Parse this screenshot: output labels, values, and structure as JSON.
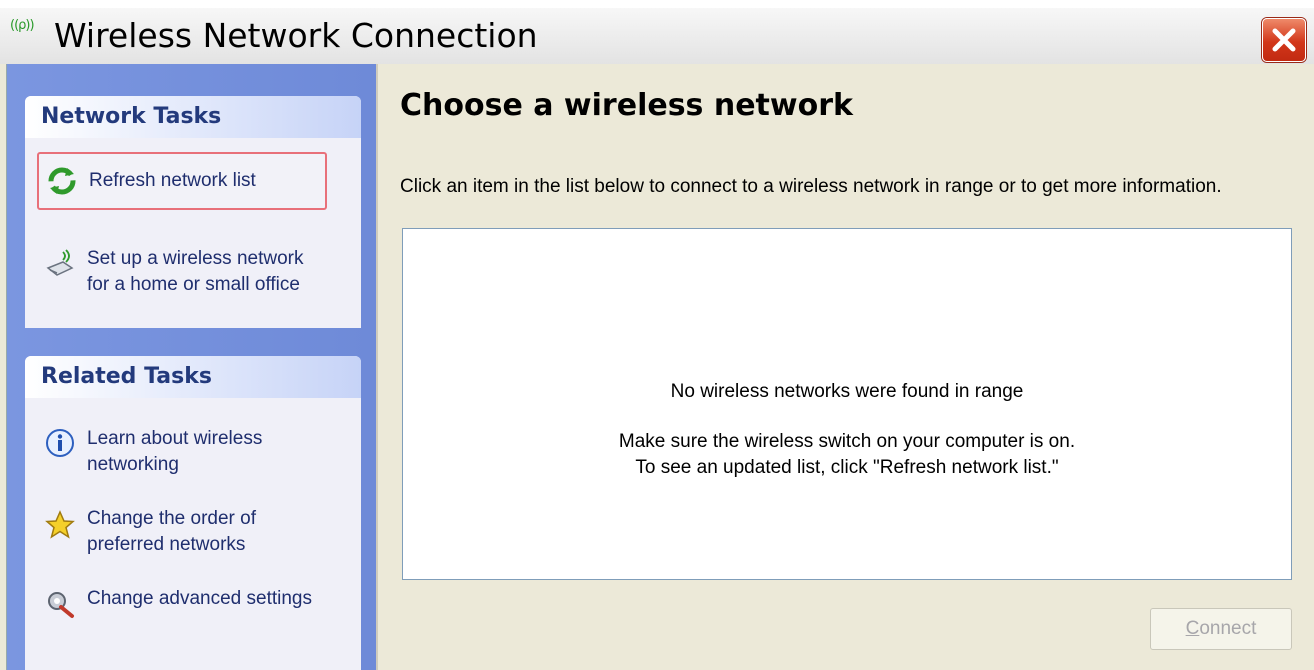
{
  "window": {
    "title": "Wireless Network Connection",
    "close_icon": "close-icon",
    "title_icon": "wireless-signal-icon",
    "signal_glyph": "((ρ))"
  },
  "network_tasks": {
    "header": "Network Tasks",
    "items": [
      {
        "label": "Refresh network list",
        "icon": "refresh-icon",
        "highlighted": true
      },
      {
        "label": "Set up a wireless network for a home or small office",
        "icon": "wireless-setup-icon"
      }
    ]
  },
  "related_tasks": {
    "header": "Related Tasks",
    "items": [
      {
        "label": "Learn about wireless networking",
        "icon": "info-icon"
      },
      {
        "label": "Change the order of preferred networks",
        "icon": "star-icon"
      },
      {
        "label": "Change advanced settings",
        "icon": "settings-icon"
      }
    ]
  },
  "main": {
    "heading": "Choose a wireless network",
    "instructions": "Click an item in the list below to connect to a wireless network in range or to get more information.",
    "list": {
      "empty_message": "No wireless networks were found in range",
      "help_line1": "Make sure the wireless switch on your computer is on.",
      "help_line2": "To see an updated list, click \"Refresh network list.\""
    },
    "connect_button": {
      "prefix": "",
      "access_key": "C",
      "rest": "onnect",
      "enabled": false
    }
  },
  "colors": {
    "task_pane": "#6e8ad8",
    "group_header_text": "#233a7c",
    "task_text": "#1f2e6e",
    "highlight_border": "#e8707a",
    "close_button": "#d2371a"
  }
}
